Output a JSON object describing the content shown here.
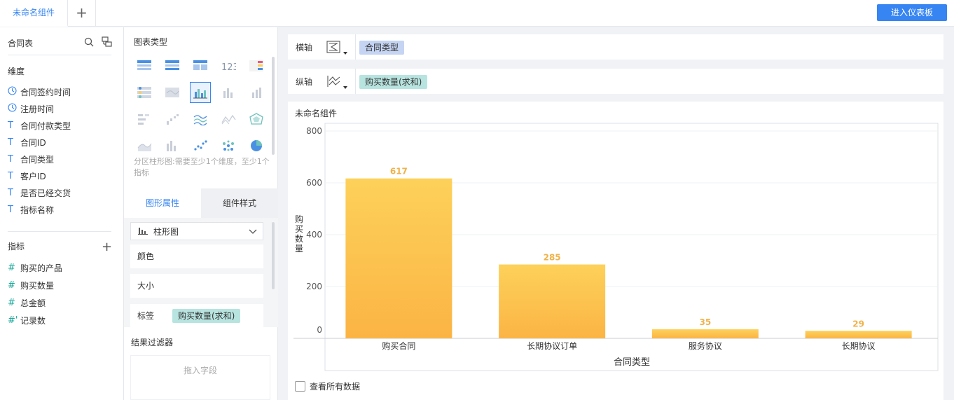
{
  "tabs": {
    "active": "未命名组件",
    "add": "+"
  },
  "header": {
    "dashboard_button": "进入仪表板"
  },
  "data_panel": {
    "table_name": "合同表",
    "dimension_title": "维度",
    "dimensions": [
      {
        "type": "time",
        "label": "合同签约时间"
      },
      {
        "type": "time",
        "label": "注册时间"
      },
      {
        "type": "text",
        "label": "合同付款类型"
      },
      {
        "type": "text",
        "label": "合同ID"
      },
      {
        "type": "text",
        "label": "合同类型"
      },
      {
        "type": "text",
        "label": "客户ID"
      },
      {
        "type": "text",
        "label": "是否已经交货"
      },
      {
        "type": "text",
        "label": "指标名称"
      }
    ],
    "measure_title": "指标",
    "measures": [
      {
        "prefix": "#",
        "label": "购买的产品"
      },
      {
        "prefix": "#",
        "label": "购买数量"
      },
      {
        "prefix": "#",
        "label": "总金额"
      },
      {
        "prefix": "#'",
        "label": "记录数"
      }
    ]
  },
  "config_panel": {
    "chart_type_title": "图表类型",
    "chart_type_hint": "分区柱形图:需要至少1个维度，至少1个指标",
    "tab_shape": "图形属性",
    "tab_style": "组件样式",
    "shape_select": "柱形图",
    "color_label": "颜色",
    "size_label": "大小",
    "tag_label": "标签",
    "tag_value": "购买数量(求和)",
    "filter_title": "结果过滤器",
    "filter_placeholder": "拖入字段"
  },
  "axes_config": {
    "x_label": "横轴",
    "x_field": "合同类型",
    "y_label": "纵轴",
    "y_field": "购买数量(求和)"
  },
  "component": {
    "title": "未命名组件",
    "show_all_data": "查看所有数据"
  },
  "chart_data": {
    "type": "bar",
    "categories": [
      "购买合同",
      "长期协议订单",
      "服务协议",
      "长期协议"
    ],
    "values": [
      617,
      285,
      35,
      29
    ],
    "xlabel": "合同类型",
    "ylabel": "购买数量",
    "yticks": [
      0,
      200,
      400,
      600,
      800
    ],
    "ylim": [
      0,
      800
    ],
    "grid": true,
    "bar_color_top": "#fdd15a",
    "bar_color_bottom": "#fbb444",
    "label_color": "#f0b24a"
  },
  "colors": {
    "accent": "#3685f2",
    "teal": "#1aa89a"
  }
}
